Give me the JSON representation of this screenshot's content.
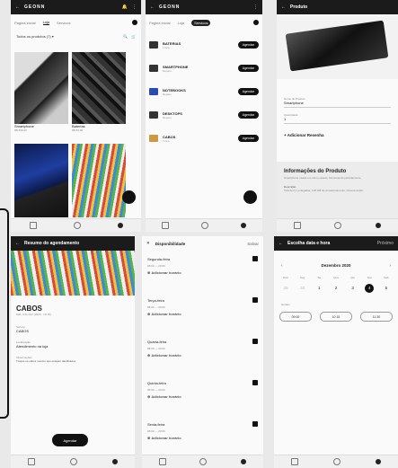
{
  "store": {
    "brand": "GEONN",
    "tabs": [
      "Pagina inicial",
      "Loja",
      "Servicos"
    ],
    "filter": "Todos os produtos (7) ▾",
    "products": [
      {
        "name": "Smartphone",
        "price": "R$ 500,00"
      },
      {
        "name": "Baterias",
        "price": "R$ 50,00"
      }
    ]
  },
  "services": {
    "brand": "GEONN",
    "tabs": [
      "Pagina inicial",
      "Loja",
      "Servicos"
    ],
    "items": [
      {
        "name": "BATERIAS",
        "sub": "Troca"
      },
      {
        "name": "SMARTPHONE",
        "sub": "Reparo"
      },
      {
        "name": "NOTEBOOKS",
        "sub": "Reparo"
      },
      {
        "name": "DESKTOPS",
        "sub": "Reparo"
      },
      {
        "name": "CABOS",
        "sub": "Troca"
      }
    ],
    "cta": "Agendar"
  },
  "product": {
    "title": "Produto",
    "name_label": "Nome do Produto",
    "name_value": "Smartphone",
    "qty_label": "Quantidade",
    "qty_value": "1",
    "add_reviews": "+ Adicionar Resenha",
    "info_title": "Informações do Produto",
    "info_text": "Smartphone usado em ótimo estado, funcionando perfeitamente.",
    "desc_label": "Descrição",
    "desc_text": "Tela de 6,1 polegadas, 128 GB de armazenamento, câmera dupla."
  },
  "booking": {
    "title": "Resumo do agendamento",
    "service": "CABOS",
    "date": "Sab, 3 de Dez (2020 · 10:15)",
    "f1_label": "Serviço",
    "f1_value": "CABOS",
    "f2_label": "Localização",
    "f2_value": "Atendimento na loja",
    "f3_label": "Observações",
    "f3_value": "Troque os cabos mesmo que estejam danificados.",
    "cta": "Agendar"
  },
  "availability": {
    "title": "Disponibilidade",
    "action": "Salvar",
    "days": [
      {
        "day": "Segunda-feira",
        "time": "08:00 — 20:00",
        "add": "Adicionar horário"
      },
      {
        "day": "Terça-feira",
        "time": "08:00 — 20:00",
        "add": "Adicionar horário"
      },
      {
        "day": "Quarta-feira",
        "time": "08:00 — 20:00",
        "add": "Adicionar horário"
      },
      {
        "day": "Quinta-feira",
        "time": "08:00 — 20:00",
        "add": "Adicionar horário"
      },
      {
        "day": "Sexta-feira",
        "time": "08:00 — 20:00",
        "add": "Adicionar horário"
      }
    ]
  },
  "datetime": {
    "title": "Escolha data e hora",
    "next": "Próximo",
    "month": "Dezembro 2020",
    "weekdays": [
      "Dom",
      "Seg",
      "Ter",
      "Qua",
      "Qui",
      "Sex",
      "Sab"
    ],
    "dates": [
      "29",
      "30",
      "1",
      "2",
      "3",
      "4",
      "5"
    ],
    "selected_index": 5,
    "time_label": "Horário",
    "times": [
      "09:00",
      "10:15",
      "11:30"
    ]
  }
}
